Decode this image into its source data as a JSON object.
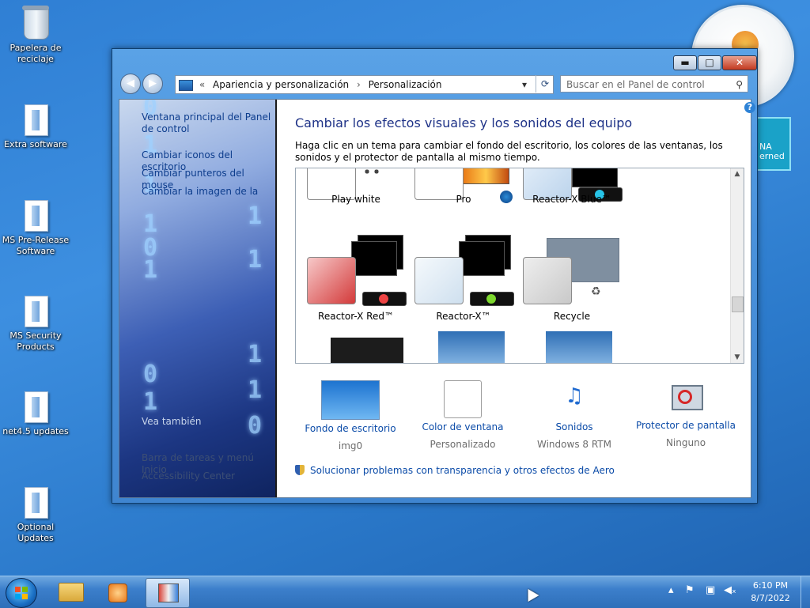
{
  "desktop": {
    "icons": [
      {
        "label": "Papelera de reciclaje",
        "type": "recycle-bin"
      },
      {
        "label": "Extra software",
        "type": "folder"
      },
      {
        "label": "MS Pre-Release Software",
        "type": "folder"
      },
      {
        "label": "MS Security Products",
        "type": "folder"
      },
      {
        "label": "net4.5 updates",
        "type": "folder"
      },
      {
        "label": "Optional Updates",
        "type": "folder"
      }
    ],
    "tile_text": "NA\nerned"
  },
  "window": {
    "controls": {
      "minimize": "▬",
      "maximize": "□",
      "close": "✕"
    },
    "address": {
      "sep": "«",
      "crumb1": "Apariencia y personalización",
      "arrow": "›",
      "crumb2": "Personalización",
      "dropdown": "▾",
      "refresh": "⟳"
    },
    "search_placeholder": "Buscar en el Panel de control",
    "left_pane": {
      "home": "Ventana principal del Panel de control",
      "links": [
        "Cambiar iconos del escritorio",
        "Cambiar punteros del mouse",
        "Cambiar la imagen de la"
      ],
      "see_also": "Vea también",
      "bottom_links": [
        "Barra de tareas y menú Inicio",
        "Accessibility Center"
      ]
    },
    "main": {
      "title": "Cambiar los efectos visuales y los sonidos del equipo",
      "description": "Haga clic en un tema para cambiar el fondo del escritorio, los colores de las ventanas, los sonidos y el protector de pantalla al mismo tiempo.",
      "themes": [
        {
          "name": "Play white"
        },
        {
          "name": "Pro"
        },
        {
          "name": "Reactor-X Blue™"
        },
        {
          "name": "Reactor-X Red™"
        },
        {
          "name": "Reactor-X™"
        },
        {
          "name": "Recycle"
        }
      ],
      "bottom_items": [
        {
          "label": "Fondo de escritorio",
          "sub": "img0"
        },
        {
          "label": "Color de ventana",
          "sub": "Personalizado"
        },
        {
          "label": "Sonidos",
          "sub": "Windows 8 RTM"
        },
        {
          "label": "Protector de pantalla",
          "sub": "Ninguno"
        }
      ],
      "aero_link": "Solucionar problemas con transparencia y otros efectos de Aero",
      "help": "?"
    }
  },
  "taskbar": {
    "time": "6:10 PM",
    "date": "8/7/2022"
  },
  "colors": {
    "link": "#0b4ba8",
    "title": "#1e3287",
    "taskbar": "#3c7fcb"
  }
}
